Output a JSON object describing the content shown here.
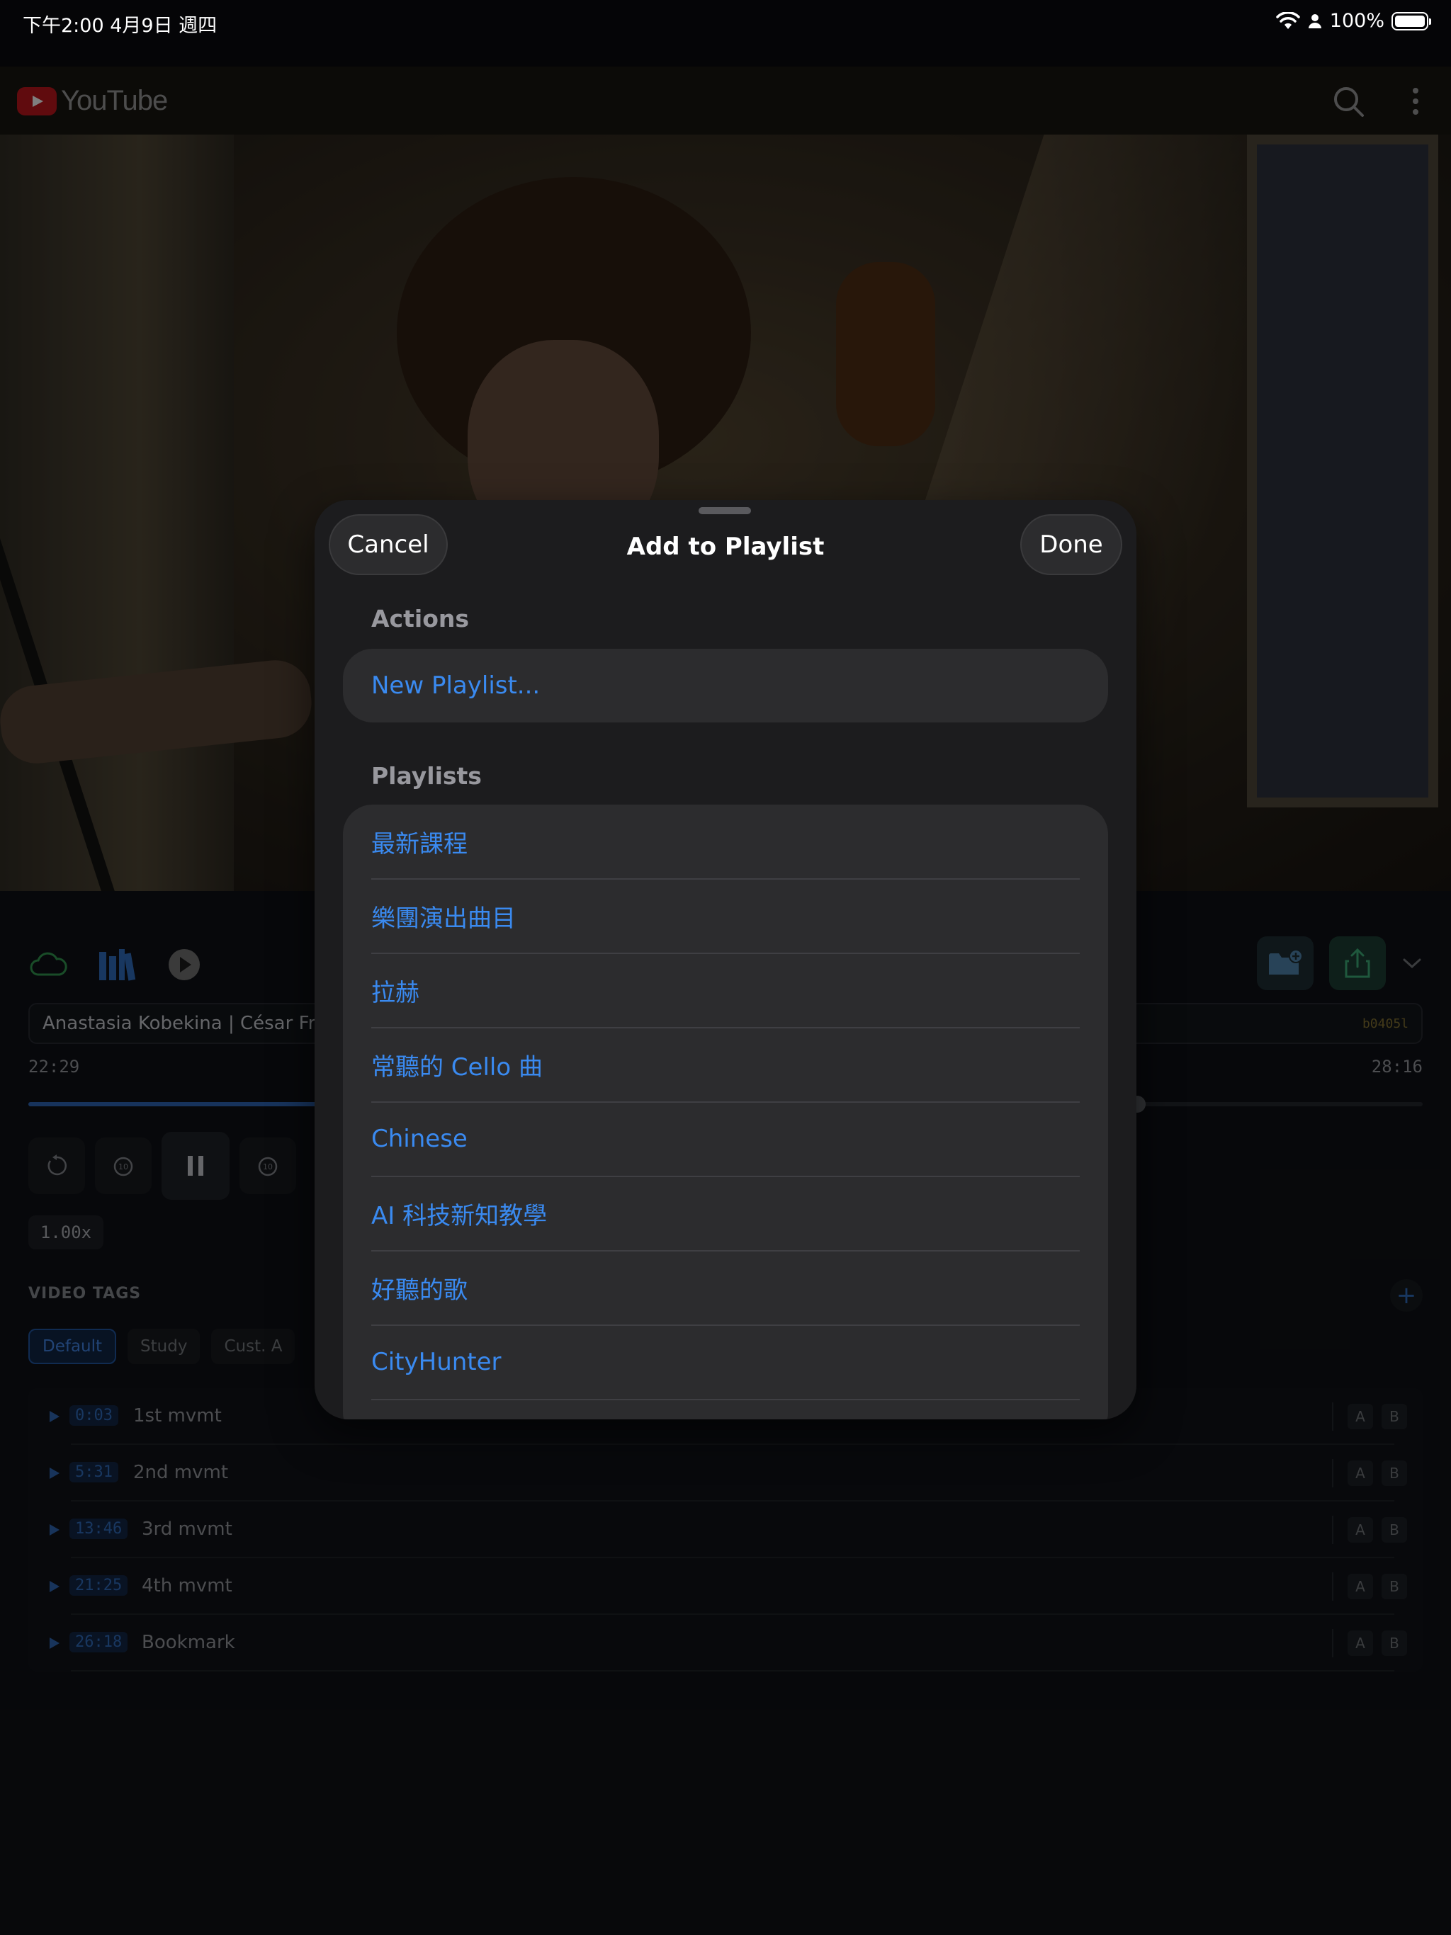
{
  "status_bar": {
    "time": "下午2:00   4月9日 週四",
    "battery": "100%"
  },
  "youtube": {
    "logo_text": "YouTube"
  },
  "player": {
    "video_title": "Anastasia Kobekina | César Franck",
    "code": "b0405l",
    "current_time": "22:29",
    "total_time": "28:16",
    "progress": 0.795,
    "speed": "1.00x",
    "tags_label": "VIDEO TAGS",
    "tags": [
      "Default",
      "Study",
      "Cust. A"
    ],
    "bookmarks": [
      {
        "time": "0:03",
        "label": "1st mvmt"
      },
      {
        "time": "5:31",
        "label": "2nd mvmt"
      },
      {
        "time": "13:46",
        "label": "3rd mvmt"
      },
      {
        "time": "21:25",
        "label": "4th mvmt"
      },
      {
        "time": "26:18",
        "label": "Bookmark"
      }
    ],
    "ab_a": "A",
    "ab_b": "B"
  },
  "sheet": {
    "title": "Add to Playlist",
    "cancel": "Cancel",
    "done": "Done",
    "actions_header": "Actions",
    "new_playlist": "New Playlist...",
    "playlists_header": "Playlists",
    "playlists": [
      "最新課程",
      "樂團演出曲目",
      "拉赫",
      "常聽的 Cello 曲",
      "Chinese",
      "AI 科技新知教學",
      "好聽的歌",
      "CityHunter"
    ]
  },
  "colors": {
    "accent_blue": "#3a8af0",
    "sheet_bg": "#1c1c1e",
    "row_bg": "#2c2c2e"
  }
}
